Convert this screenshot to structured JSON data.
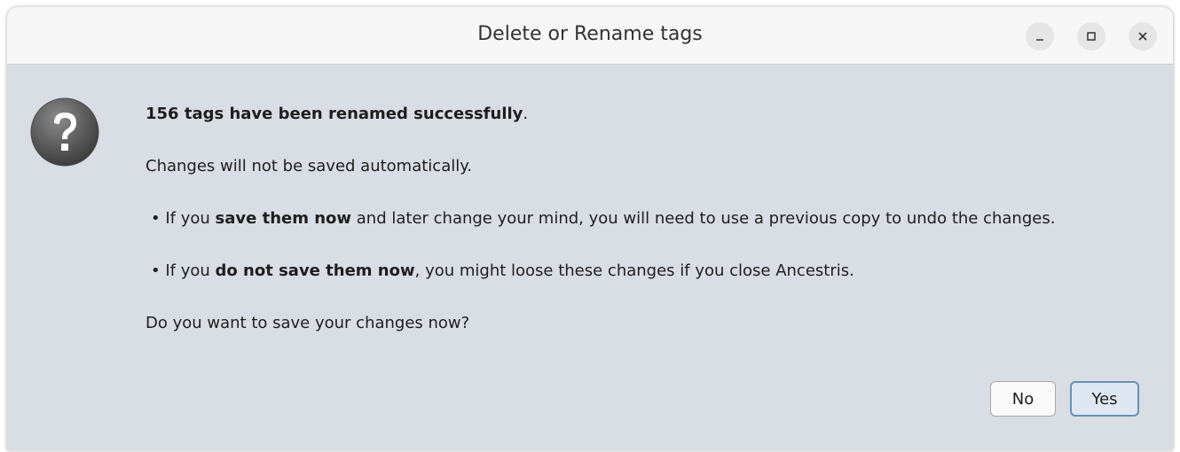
{
  "window": {
    "title": "Delete or Rename tags",
    "controls": {
      "minimize": "minimize-icon",
      "maximize": "maximize-icon",
      "close": "close-icon"
    }
  },
  "dialog": {
    "icon": "question-icon",
    "line1": {
      "bold": "156 tags have been renamed successfully",
      "after": "."
    },
    "line2": "Changes will not be saved automatically.",
    "line3": {
      "before": "• If you ",
      "bold": "save them now",
      "after": " and later change your mind, you will need to use a previous copy to undo the changes."
    },
    "line4": {
      "before": "• If you ",
      "bold": "do not save them now",
      "after": ", you might loose these changes if you close Ancestris."
    },
    "line5": "Do you want to save your changes now?"
  },
  "buttons": {
    "no": "No",
    "yes": "Yes"
  },
  "colors": {
    "dialog_bg": "#d9dde4",
    "titlebar_bg": "#f7f7f7",
    "default_button_border": "#6a8fb4"
  }
}
